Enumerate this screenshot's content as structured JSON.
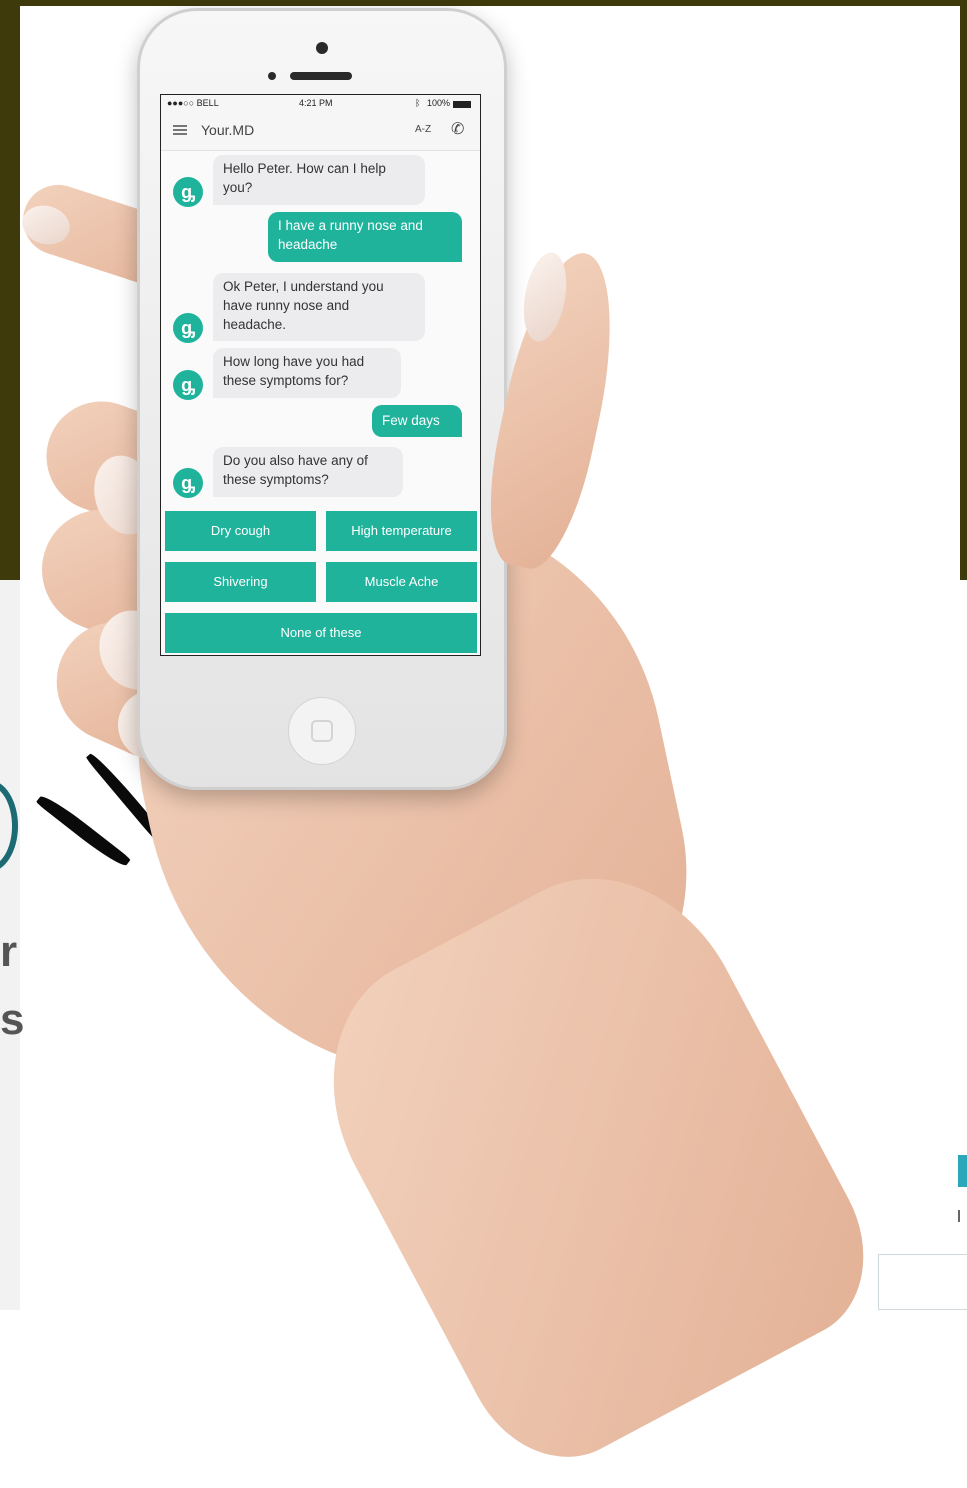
{
  "status_bar": {
    "carrier": "●●●○○ BELL",
    "time": "4:21 PM",
    "battery": "100%"
  },
  "app_bar": {
    "title": "Your.MD",
    "az_label": "A-Z"
  },
  "chat": [
    {
      "from": "bot",
      "text": "Hello Peter. How can I help you?"
    },
    {
      "from": "user",
      "text": "I have a runny nose and headache"
    },
    {
      "from": "bot",
      "text": "Ok Peter, I understand you have runny nose and headache."
    },
    {
      "from": "bot",
      "text": "How long have you had these symptoms for?"
    },
    {
      "from": "user",
      "text": "Few days"
    },
    {
      "from": "bot",
      "text": "Do you also have any of these symptoms?"
    }
  ],
  "options": [
    "Dry cough",
    "High temperature",
    "Shivering",
    "Muscle Ache",
    "None of these"
  ],
  "side_text": [
    "r",
    "s"
  ],
  "colors": {
    "accent": "#1fb39c",
    "frame": "#3f3a0c",
    "teal_bar": "#2aa7b8"
  },
  "icons": {
    "avatar": "stethoscope-icon",
    "menu": "hamburger-icon",
    "call": "phone-icon"
  }
}
